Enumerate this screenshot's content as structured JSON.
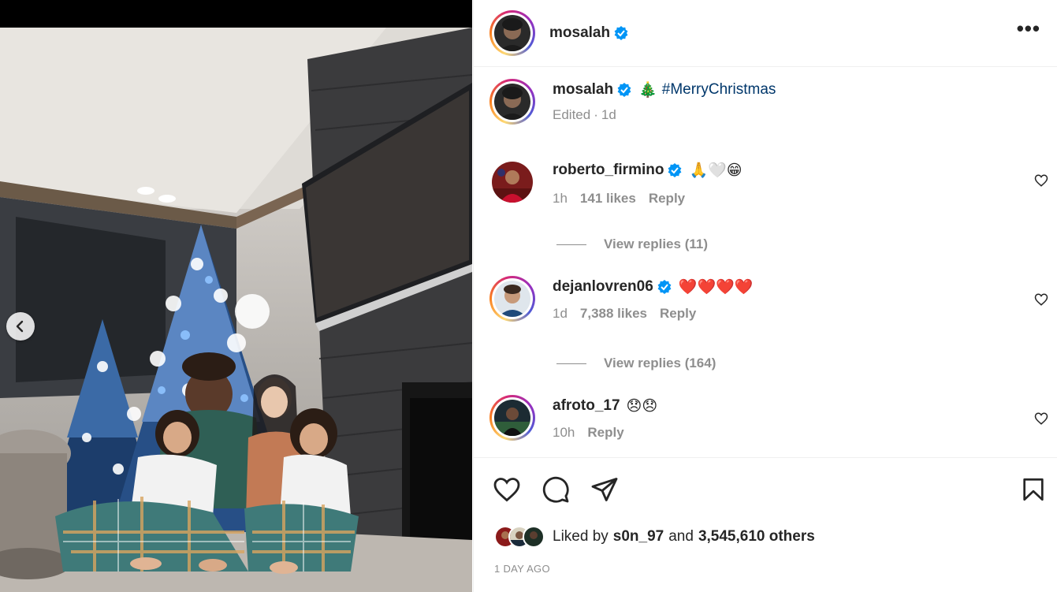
{
  "post": {
    "author": "mosalah",
    "caption_emoji": "🎄",
    "caption_hashtag": "#MerryChristmas",
    "edited_label": "Edited",
    "age": "1d",
    "liked_by_prefix": "Liked by",
    "liked_by_user": "s0n_97",
    "liked_by_and": "and",
    "likes_others": "3,545,610 others",
    "timestamp": "1 DAY AGO"
  },
  "header": {
    "username": "mosalah",
    "more_label": "•••"
  },
  "comments": [
    {
      "username": "roberto_firmino",
      "text": "🙏🤍😁",
      "time": "1h",
      "likes": "141 likes",
      "reply": "Reply",
      "view_replies": "View replies (11)"
    },
    {
      "username": "dejanlovren06",
      "text": "❤️❤️❤️❤️",
      "time": "1d",
      "likes": "7,388 likes",
      "reply": "Reply",
      "view_replies": "View replies (164)"
    },
    {
      "username": "afroto_17",
      "text": "😞😞",
      "time": "10h",
      "reply": "Reply"
    }
  ],
  "icons": {
    "prev": "chevron-left-icon",
    "verified": "verified-badge-icon",
    "like": "heart-icon",
    "comment": "comment-icon",
    "share": "send-icon",
    "save": "bookmark-icon"
  },
  "colors": {
    "link": "#00376b",
    "verified": "#0095f6",
    "muted": "#8e8e8e",
    "text": "#262626"
  }
}
